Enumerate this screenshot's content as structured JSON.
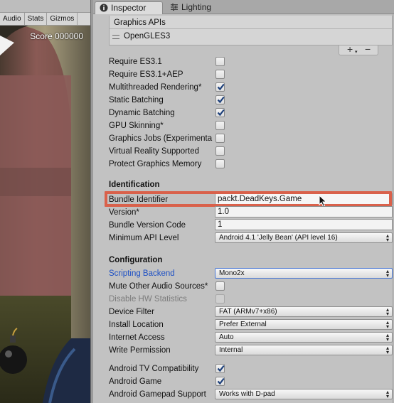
{
  "game_view": {
    "toolbar": [
      "Audio",
      "Stats",
      "Gizmos"
    ],
    "score": "Score 000000"
  },
  "tabs": {
    "inspector": "Inspector",
    "lighting": "Lighting"
  },
  "graphics_apis": {
    "header": "Graphics APIs",
    "items": [
      "OpenGLES3"
    ],
    "add": "+",
    "remove": "−"
  },
  "rendering": [
    {
      "label": "Require ES3.1",
      "checked": false
    },
    {
      "label": "Require ES3.1+AEP",
      "checked": false
    },
    {
      "label": "Multithreaded Rendering*",
      "checked": true
    },
    {
      "label": "Static Batching",
      "checked": true
    },
    {
      "label": "Dynamic Batching",
      "checked": true
    },
    {
      "label": "GPU Skinning*",
      "checked": false
    },
    {
      "label": "Graphics Jobs (Experimenta",
      "checked": false
    },
    {
      "label": "Virtual Reality Supported",
      "checked": false
    },
    {
      "label": "Protect Graphics Memory",
      "checked": false
    }
  ],
  "identification": {
    "title": "Identification",
    "bundle_identifier_label": "Bundle Identifier",
    "bundle_identifier_value": "packt.DeadKeys.Game",
    "version_label": "Version*",
    "version_value": "1.0",
    "bundle_version_code_label": "Bundle Version Code",
    "bundle_version_code_value": "1",
    "min_api_label": "Minimum API Level",
    "min_api_value": "Android 4.1 'Jelly Bean' (API level 16)"
  },
  "configuration": {
    "title": "Configuration",
    "scripting_backend_label": "Scripting Backend",
    "scripting_backend_value": "Mono2x",
    "mute_audio_label": "Mute Other Audio Sources*",
    "disable_hw_label": "Disable HW Statistics",
    "device_filter_label": "Device Filter",
    "device_filter_value": "FAT (ARMv7+x86)",
    "install_location_label": "Install Location",
    "install_location_value": "Prefer External",
    "internet_access_label": "Internet Access",
    "internet_access_value": "Auto",
    "write_permission_label": "Write Permission",
    "write_permission_value": "Internal",
    "android_tv_label": "Android TV Compatibility",
    "android_game_label": "Android Game",
    "gamepad_label": "Android Gamepad Support",
    "gamepad_value": "Works with D-pad"
  },
  "colors": {
    "highlight": "#d9614b",
    "link": "#1c4fc4"
  }
}
